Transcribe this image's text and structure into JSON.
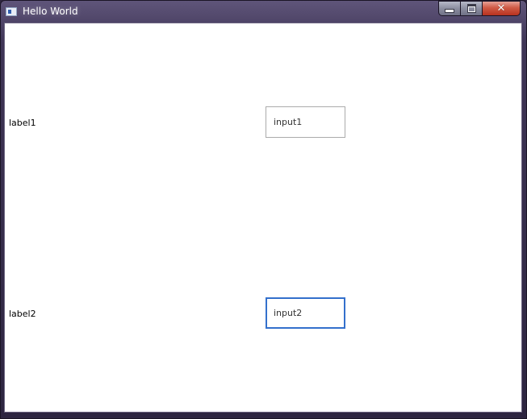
{
  "window": {
    "title": "Hello World",
    "icon": "app-window-icon",
    "controls": {
      "minimize_icon": "minimize-icon",
      "maximize_icon": "maximize-icon",
      "close_icon": "close-icon",
      "close_glyph": "✕"
    }
  },
  "form": {
    "label1": "label1",
    "input1_value": "input1",
    "label2": "label2",
    "input2_value": "input2"
  },
  "colors": {
    "focus_border": "#3370cc",
    "input_border": "#ababab",
    "close_button": "#c7412c",
    "frame": "#2f2740"
  }
}
